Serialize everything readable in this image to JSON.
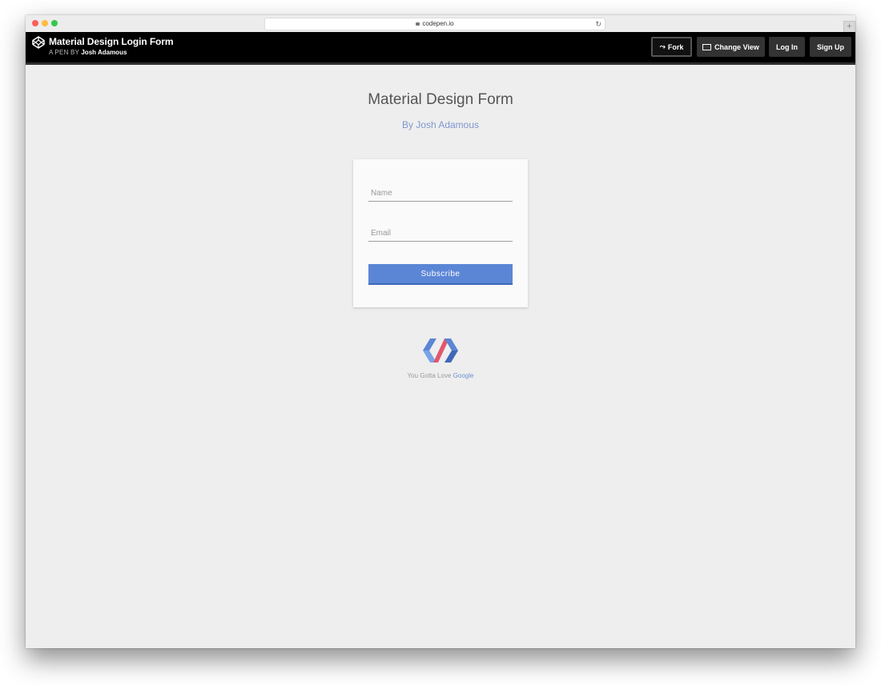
{
  "browser": {
    "url": "codepen.io"
  },
  "codepen": {
    "pen_title": "Material Design Login Form",
    "byline_prefix": "A PEN BY",
    "byline_author": "Josh Adamous",
    "buttons": {
      "fork": "Fork",
      "change_view": "Change View",
      "log_in": "Log In",
      "sign_up": "Sign Up"
    }
  },
  "page": {
    "title": "Material Design Form",
    "subtitle": "By Josh Adamous"
  },
  "form": {
    "name_placeholder": "Name",
    "email_placeholder": "Email",
    "submit_label": "Subscribe"
  },
  "footer": {
    "text_prefix": "You Gotta Love",
    "text_link": "Google"
  },
  "colors": {
    "header_bg": "#000000",
    "page_bg": "#eeeeee",
    "accent_blue": "#5b86d6",
    "subtitle_blue": "#7f97cf"
  },
  "icons": {
    "fork": "fork-icon",
    "change_view": "layout-icon",
    "lock": "lock-icon",
    "reload": "reload-icon",
    "codepen_logo": "codepen-logo-icon",
    "polymer_logo": "polymer-logo-icon"
  }
}
